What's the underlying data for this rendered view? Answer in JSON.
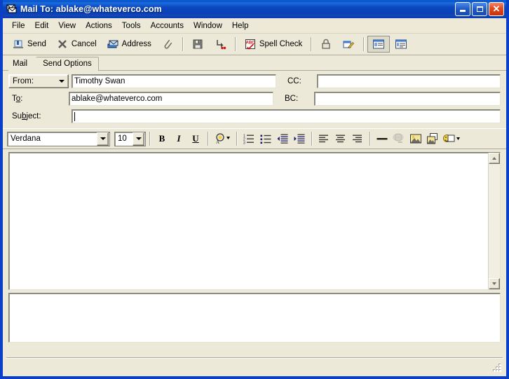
{
  "window": {
    "title": "Mail To: ablake@whateverco.com",
    "app_icon": "mail-envelope-icon",
    "controls": {
      "minimize": "Minimize",
      "maximize": "Maximize",
      "close": "Close"
    },
    "titlebar_color": "#0a40c8",
    "face_color": "#ece9d8"
  },
  "menu": {
    "items": [
      {
        "label": "File"
      },
      {
        "label": "Edit"
      },
      {
        "label": "View"
      },
      {
        "label": "Actions"
      },
      {
        "label": "Tools"
      },
      {
        "label": "Accounts"
      },
      {
        "label": "Window"
      },
      {
        "label": "Help"
      }
    ]
  },
  "toolbar": {
    "send_label": "Send",
    "cancel_label": "Cancel",
    "address_label": "Address",
    "spell_label": "Spell Check",
    "attach_tip": "Attach a File",
    "save_tip": "Save Draft",
    "save_as_tip": "Save As",
    "lock_tip": "Security Options",
    "sign_tip": "Sign Message",
    "view_split_tip": "Show Header Pane",
    "view_list_tip": "Show Message Pane"
  },
  "tabs": [
    {
      "label": "Mail",
      "active": true
    },
    {
      "label": "Send Options",
      "active": false
    }
  ],
  "headers": {
    "from_label": "From:",
    "from_value": "Timothy Swan",
    "to_label_pre": "T",
    "to_label_accel": "o",
    "to_label_post": ":",
    "to_value": "ablake@whateverco.com",
    "subject_label_pre": "Su",
    "subject_label_accel": "b",
    "subject_label_post": "ject:",
    "subject_value": "",
    "cc_label": "CC:",
    "cc_value": "",
    "bc_label": "BC:",
    "bc_value": ""
  },
  "format_toolbar": {
    "font_name": "Verdana",
    "font_size": "10",
    "bold": "B",
    "italic": "I",
    "underline": "U",
    "font_color_tip": "Font Color",
    "numbered_list_tip": "Numbered List",
    "bulleted_list_tip": "Bulleted List",
    "decrease_indent_tip": "Decrease Indent",
    "increase_indent_tip": "Increase Indent",
    "align_left_tip": "Align Left",
    "align_center_tip": "Center",
    "align_right_tip": "Align Right",
    "horizontal_line_tip": "Horizontal Line",
    "hyperlink_tip": "Insert Hyperlink",
    "image_tip": "Insert Image",
    "object_tip": "Insert Object",
    "emoticon_tip": "Insert Emoticon"
  },
  "body": {
    "text": "",
    "scroll_up_tip": "Scroll Up",
    "scroll_down_tip": "Scroll Down"
  },
  "attachments": {
    "items": []
  },
  "statusbar": {
    "text": "",
    "grip_tip": "Resize"
  }
}
